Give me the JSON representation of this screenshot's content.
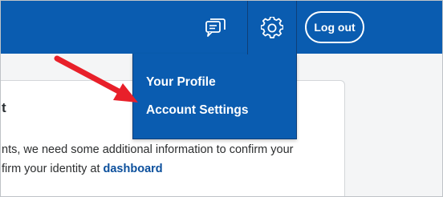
{
  "header": {
    "messages_icon": "message-icon",
    "settings_icon": "gear-icon",
    "logout_label": "Log out"
  },
  "dropdown": {
    "items": [
      {
        "label": "Your Profile"
      },
      {
        "label": "Account Settings"
      }
    ]
  },
  "card": {
    "title_fragment": "t",
    "line1": "nts, we need some additional information to confirm your",
    "line2_prefix": "firm your identity at ",
    "line2_link": "dashboard"
  },
  "annotation": {
    "arrow_color": "#e8202a"
  },
  "colors": {
    "header_bg": "#0a5cb0",
    "link": "#0b4f9c"
  }
}
